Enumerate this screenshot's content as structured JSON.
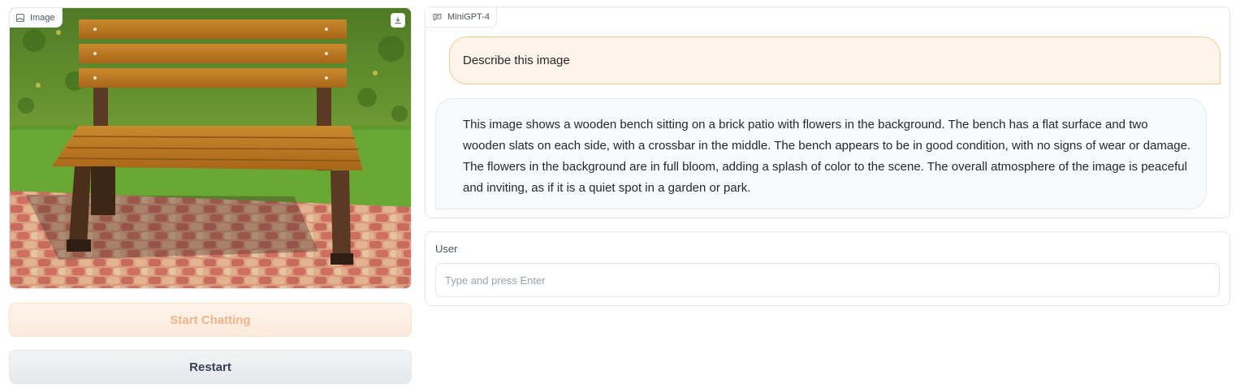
{
  "image_panel": {
    "label": "Image",
    "label_icon": "image-icon",
    "download_icon": "download-icon",
    "content": "wooden-bench-photo"
  },
  "buttons": {
    "start_label": "Start Chatting",
    "restart_label": "Restart"
  },
  "chatbot": {
    "label": "MiniGPT-4",
    "label_icon": "chat-icon",
    "messages": [
      {
        "role": "user",
        "text": "Describe this image"
      },
      {
        "role": "bot",
        "text": "This image shows a wooden bench sitting on a brick patio with flowers in the background. The bench has a flat surface and two wooden slats on each side, with a crossbar in the middle. The bench appears to be in good condition, with no signs of wear or damage. The flowers in the background are in full bloom, adding a splash of color to the scene. The overall atmosphere of the image is peaceful and inviting, as if it is a quiet spot in a garden or park."
      }
    ]
  },
  "user_input": {
    "label": "User",
    "placeholder": "Type and press Enter",
    "value": ""
  },
  "colors": {
    "accent": "#f97316",
    "user_bubble_bg": "#fff4ea",
    "user_bubble_border": "#f8c88f",
    "bot_bubble_bg": "#f9fafb"
  }
}
